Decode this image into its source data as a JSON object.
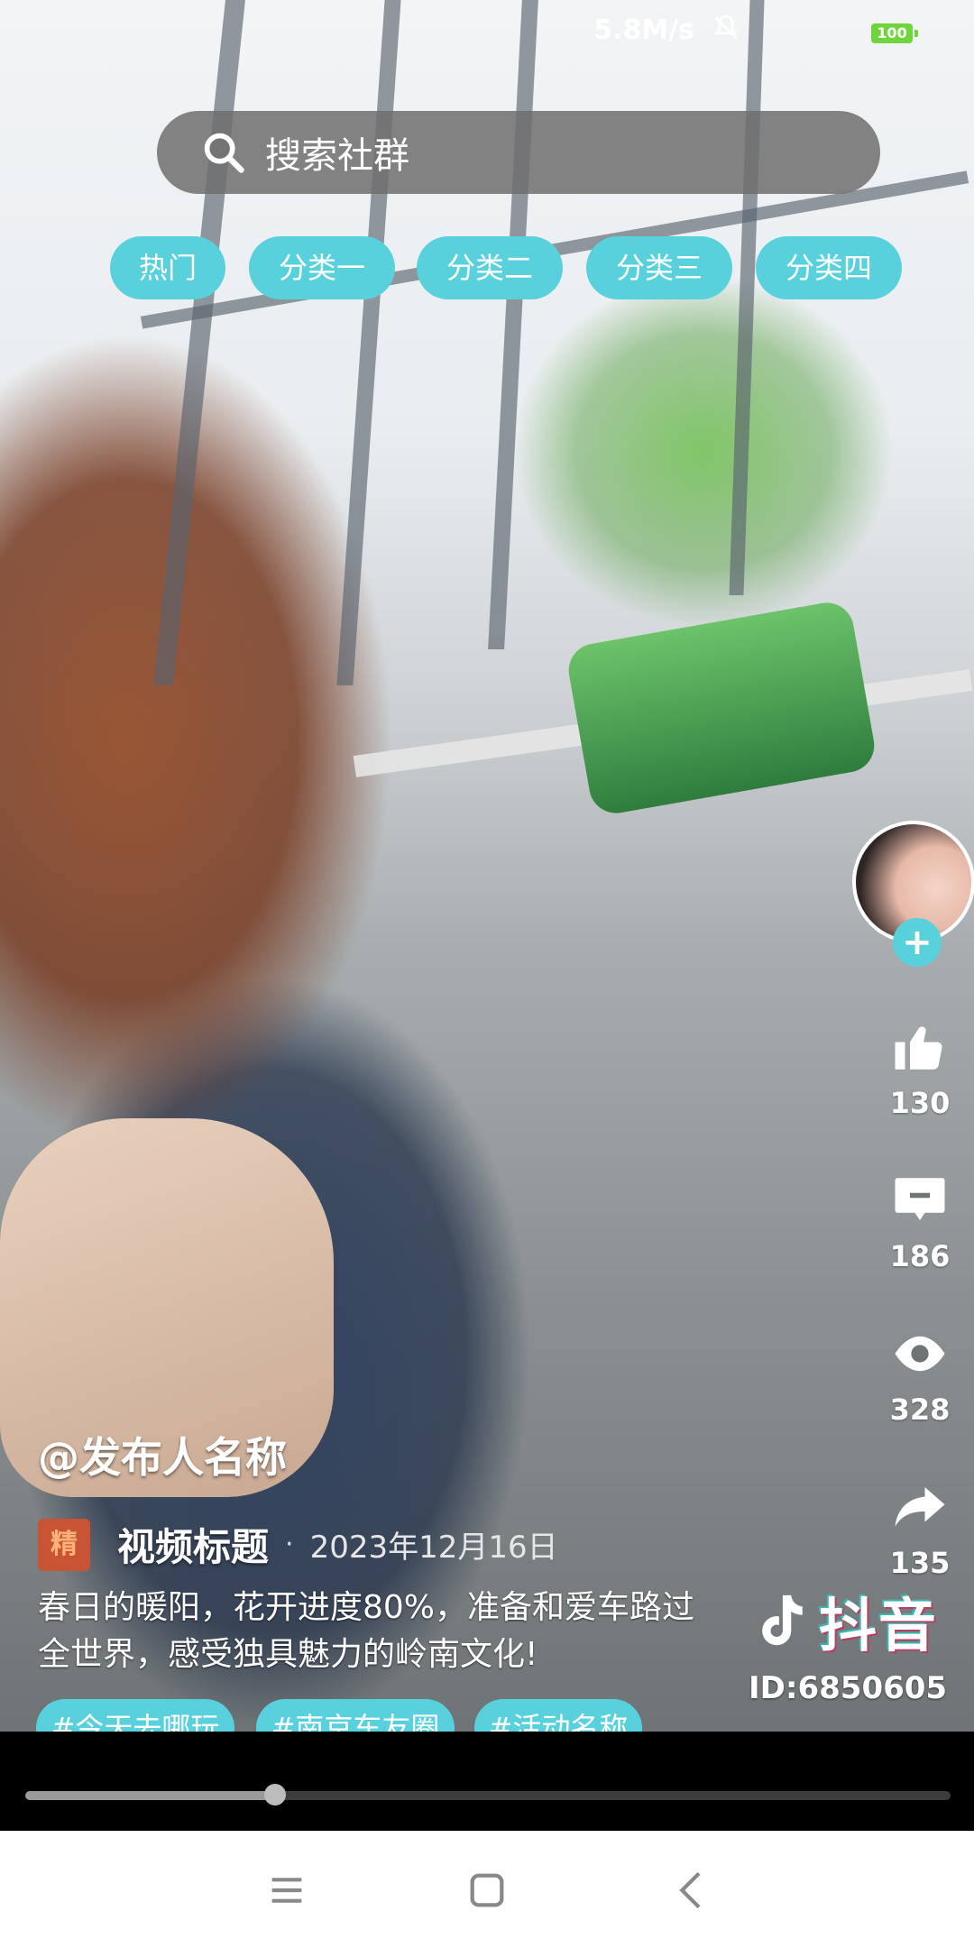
{
  "status_bar": {
    "network_speed": "5.8M/s",
    "battery": "100",
    "battery_color": "#6fd53c"
  },
  "search": {
    "placeholder": "搜索社群"
  },
  "tabs": [
    "热门",
    "分类一",
    "分类二",
    "分类三",
    "分类四"
  ],
  "accent_color": "#59d1dc",
  "actions": {
    "likes": "130",
    "comments": "186",
    "views": "328",
    "shares": "135"
  },
  "post": {
    "author": "@发布人名称",
    "badge": "精",
    "title": "视频标题",
    "separator": "·",
    "date": "2023年12月16日",
    "description": "春日的暖阳，花开进度80%，准备和爱车路过全世界，感受独具魅力的岭南文化!",
    "hashtags": [
      "#今天去哪玩",
      "#南京车友圈",
      "#活动名称"
    ]
  },
  "watermark": {
    "brand": "抖音",
    "id": "ID:6850605"
  },
  "player": {
    "progress": 0.27
  },
  "icons": [
    "search-icon",
    "bell-mute-icon",
    "like-icon",
    "comment-icon",
    "eye-icon",
    "share-icon",
    "plus-icon",
    "menu-icon",
    "home-square-icon",
    "back-chevron-icon"
  ]
}
